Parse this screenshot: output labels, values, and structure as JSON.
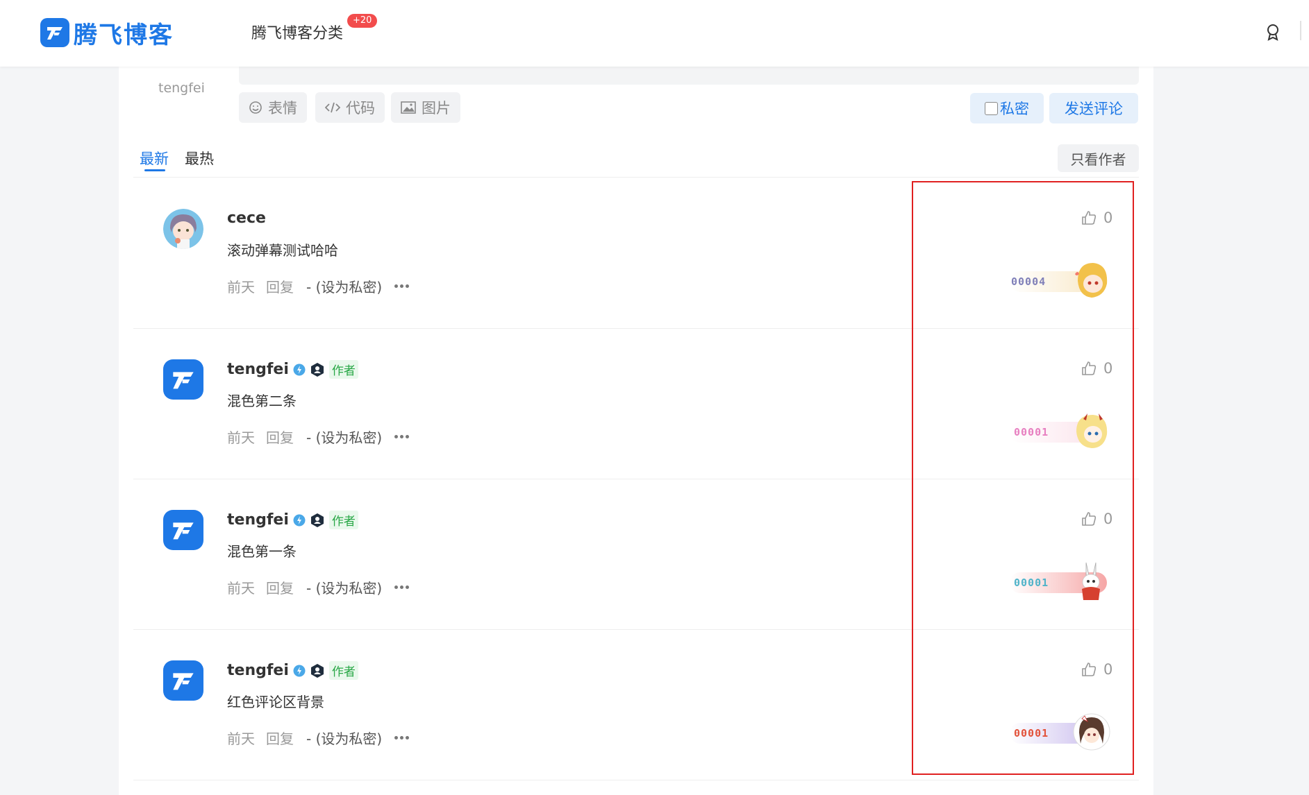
{
  "header": {
    "logo_text": "腾飞博客",
    "nav_category": "腾飞博客分类",
    "nav_badge": "+20"
  },
  "composer": {
    "username": "tengfei",
    "emoji_label": "表情",
    "code_label": "代码",
    "image_label": "图片",
    "private_label": "私密",
    "send_label": "发送评论"
  },
  "sort": {
    "newest": "最新",
    "hottest": "最热",
    "only_author": "只看作者"
  },
  "comments": [
    {
      "name": "cece",
      "is_author": false,
      "text": "滚动弹幕测试哈哈",
      "time": "前天",
      "reply": "回复",
      "private_action": "- (设为私密)",
      "likes": "0",
      "fan_number": "00004",
      "fan_color": "#7f7fb8"
    },
    {
      "name": "tengfei",
      "is_author": true,
      "author_tag": "作者",
      "text": "混色第二条",
      "time": "前天",
      "reply": "回复",
      "private_action": "- (设为私密)",
      "likes": "0",
      "fan_number": "00001",
      "fan_color": "#e77fc0"
    },
    {
      "name": "tengfei",
      "is_author": true,
      "author_tag": "作者",
      "text": "混色第一条",
      "time": "前天",
      "reply": "回复",
      "private_action": "- (设为私密)",
      "likes": "0",
      "fan_number": "00001",
      "fan_color": "#4fb3c9"
    },
    {
      "name": "tengfei",
      "is_author": true,
      "author_tag": "作者",
      "text": "红色评论区背景",
      "time": "前天",
      "reply": "回复",
      "private_action": "- (设为私密)",
      "likes": "0",
      "fan_number": "00001",
      "fan_color": "#e2523a"
    }
  ],
  "colors": {
    "accent": "#1e78e6",
    "badge_red": "#f24c4c",
    "author_green": "#27a745",
    "highlight_red": "#e02020"
  }
}
